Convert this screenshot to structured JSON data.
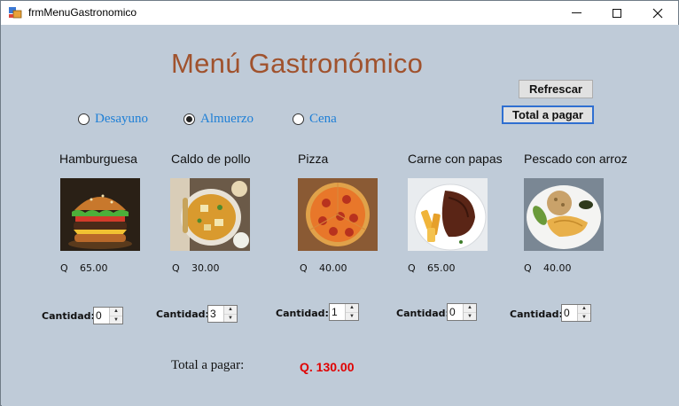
{
  "window": {
    "title": "frmMenuGastronomico"
  },
  "header": {
    "title": "Menú Gastronómico"
  },
  "buttons": {
    "refresh": "Refrescar",
    "total": "Total a pagar"
  },
  "meal_options": [
    {
      "label": "Desayuno",
      "selected": false
    },
    {
      "label": "Almuerzo",
      "selected": true
    },
    {
      "label": "Cena",
      "selected": false
    }
  ],
  "dishes": [
    {
      "name": "Hamburguesa",
      "currency": "Q",
      "price": "65.00",
      "quantity_label": "Cantidad:",
      "quantity": "0"
    },
    {
      "name": "Caldo de pollo",
      "currency": "Q",
      "price": "30.00",
      "quantity_label": "Cantidad:",
      "quantity": "3"
    },
    {
      "name": "Pizza",
      "currency": "Q",
      "price": "40.00",
      "quantity_label": "Cantidad:",
      "quantity": "1"
    },
    {
      "name": "Carne con papas",
      "currency": "Q",
      "price": "65.00",
      "quantity_label": "Cantidad:",
      "quantity": "0"
    },
    {
      "name": "Pescado con arroz",
      "currency": "Q",
      "price": "40.00",
      "quantity_label": "Cantidad:",
      "quantity": "0"
    }
  ],
  "total": {
    "label": "Total a pagar:",
    "value": "Q. 130.00"
  },
  "colors": {
    "background": "#bfcbd8",
    "title": "#a0522d",
    "radio_text": "#1e7fd6",
    "total_value": "#e00000"
  }
}
